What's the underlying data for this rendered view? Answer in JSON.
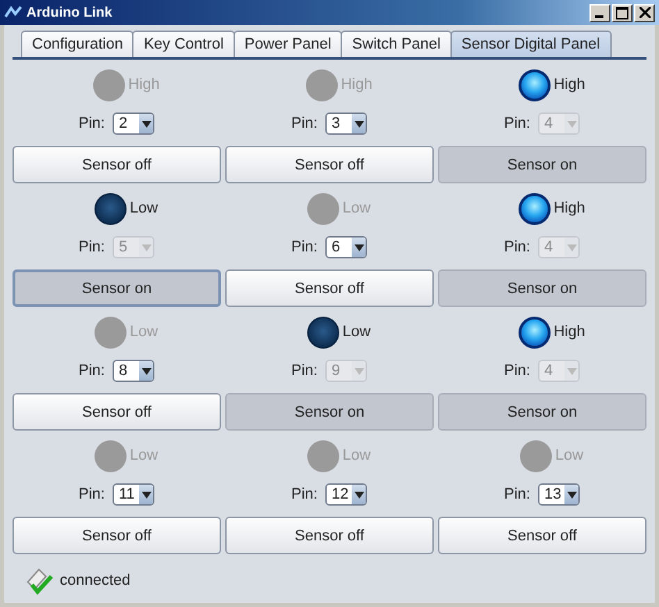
{
  "window": {
    "title": "Arduino Link"
  },
  "tabs": [
    {
      "label": "Configuration",
      "selected": false
    },
    {
      "label": "Key Control",
      "selected": false
    },
    {
      "label": "Power Panel",
      "selected": false
    },
    {
      "label": "Switch Panel",
      "selected": false
    },
    {
      "label": "Sensor Digital Panel",
      "selected": true
    }
  ],
  "sensors": [
    {
      "active": false,
      "reading": "High",
      "pin_label": "Pin:",
      "pin": "2",
      "pin_disabled": false,
      "button": "Sensor off",
      "pressed": false,
      "focused": false
    },
    {
      "active": false,
      "reading": "High",
      "pin_label": "Pin:",
      "pin": "3",
      "pin_disabled": false,
      "button": "Sensor off",
      "pressed": false,
      "focused": false
    },
    {
      "active": true,
      "high": true,
      "reading": "High",
      "pin_label": "Pin:",
      "pin": "4",
      "pin_disabled": true,
      "button": "Sensor on",
      "pressed": true,
      "focused": false
    },
    {
      "active": true,
      "high": false,
      "reading": "Low",
      "pin_label": "Pin:",
      "pin": "5",
      "pin_disabled": true,
      "button": "Sensor on",
      "pressed": true,
      "focused": true
    },
    {
      "active": false,
      "reading": "Low",
      "pin_label": "Pin:",
      "pin": "6",
      "pin_disabled": false,
      "button": "Sensor off",
      "pressed": false,
      "focused": false
    },
    {
      "active": true,
      "high": true,
      "reading": "High",
      "pin_label": "Pin:",
      "pin": "4",
      "pin_disabled": true,
      "button": "Sensor on",
      "pressed": true,
      "focused": false
    },
    {
      "active": false,
      "reading": "Low",
      "pin_label": "Pin:",
      "pin": "8",
      "pin_disabled": false,
      "button": "Sensor off",
      "pressed": false,
      "focused": false
    },
    {
      "active": true,
      "high": false,
      "reading": "Low",
      "pin_label": "Pin:",
      "pin": "9",
      "pin_disabled": true,
      "button": "Sensor on",
      "pressed": true,
      "focused": false
    },
    {
      "active": true,
      "high": true,
      "reading": "High",
      "pin_label": "Pin:",
      "pin": "4",
      "pin_disabled": true,
      "button": "Sensor on",
      "pressed": true,
      "focused": false
    },
    {
      "active": false,
      "reading": "Low",
      "pin_label": "Pin:",
      "pin": "11",
      "pin_disabled": false,
      "button": "Sensor off",
      "pressed": false,
      "focused": false
    },
    {
      "active": false,
      "reading": "Low",
      "pin_label": "Pin:",
      "pin": "12",
      "pin_disabled": false,
      "button": "Sensor off",
      "pressed": false,
      "focused": false
    },
    {
      "active": false,
      "reading": "Low",
      "pin_label": "Pin:",
      "pin": "13",
      "pin_disabled": false,
      "button": "Sensor off",
      "pressed": false,
      "focused": false
    }
  ],
  "status": {
    "text": "connected"
  }
}
